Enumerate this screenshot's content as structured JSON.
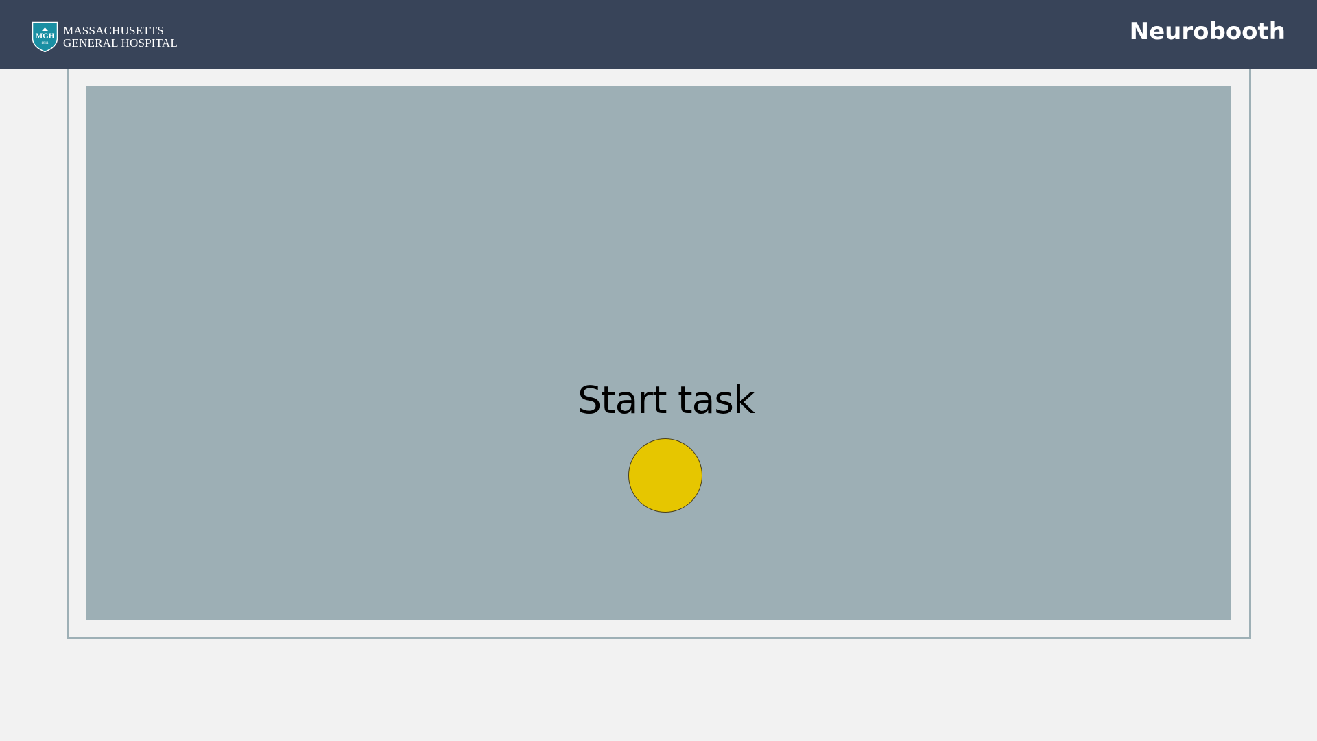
{
  "header": {
    "logo": {
      "line1": "MASSACHUSETTS",
      "line2": "GENERAL HOSPITAL",
      "badge_text": "MGH",
      "badge_year": "1811",
      "icon": "mgh-shield-icon"
    },
    "app_title": "Neurobooth"
  },
  "task": {
    "prompt": "Start task",
    "target_icon": "yellow-circle-target"
  },
  "colors": {
    "header_bg": "#384459",
    "page_bg": "#f2f2f2",
    "stage_bg": "#9dafb5",
    "frame_border": "#9eb0b6",
    "shield": "#1a8fa3",
    "target_fill": "#e6c600"
  }
}
